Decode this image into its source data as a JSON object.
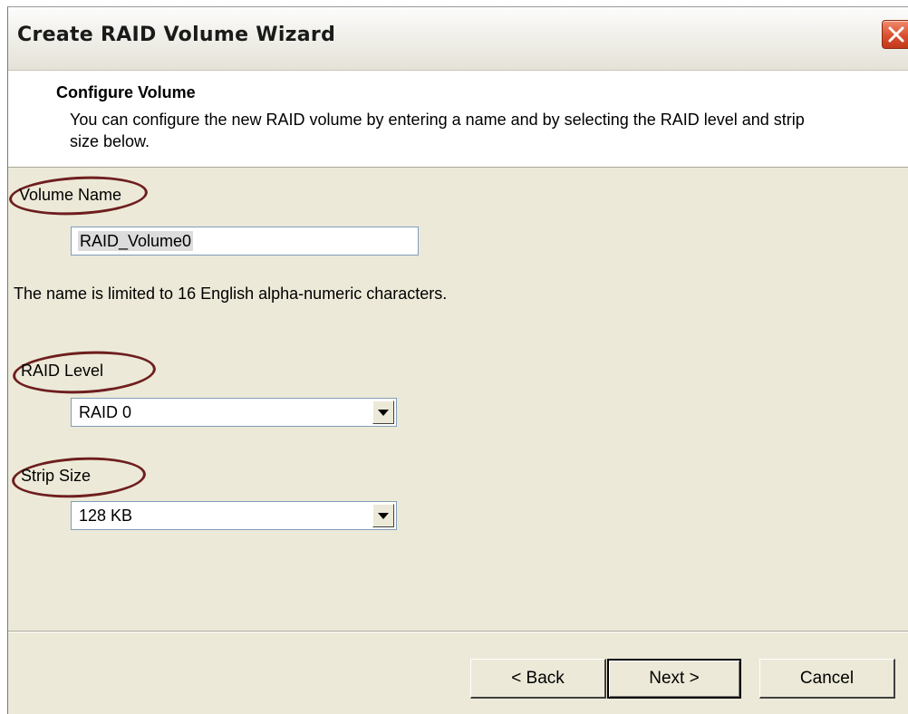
{
  "window": {
    "title": "Create RAID Volume Wizard"
  },
  "header": {
    "title": "Configure Volume",
    "description": "You can configure the new RAID volume by entering a name and by selecting the RAID level and strip size below."
  },
  "form": {
    "volume_name_label": "Volume Name",
    "volume_name_value": "RAID_Volume0",
    "name_note": "The name is limited to 16 English alpha-numeric characters.",
    "raid_level_label": "RAID Level",
    "raid_level_value": "RAID 0",
    "strip_size_label": "Strip Size",
    "strip_size_value": "128 KB"
  },
  "buttons": {
    "back": "< Back",
    "next": "Next >",
    "cancel": "Cancel"
  },
  "icons": {
    "close": "close-icon",
    "dropdown": "chevron-down-icon"
  },
  "colors": {
    "annotation_circle": "#6e1e1e",
    "close_button": "#d9502f",
    "dialog_background": "#ece9d8"
  }
}
